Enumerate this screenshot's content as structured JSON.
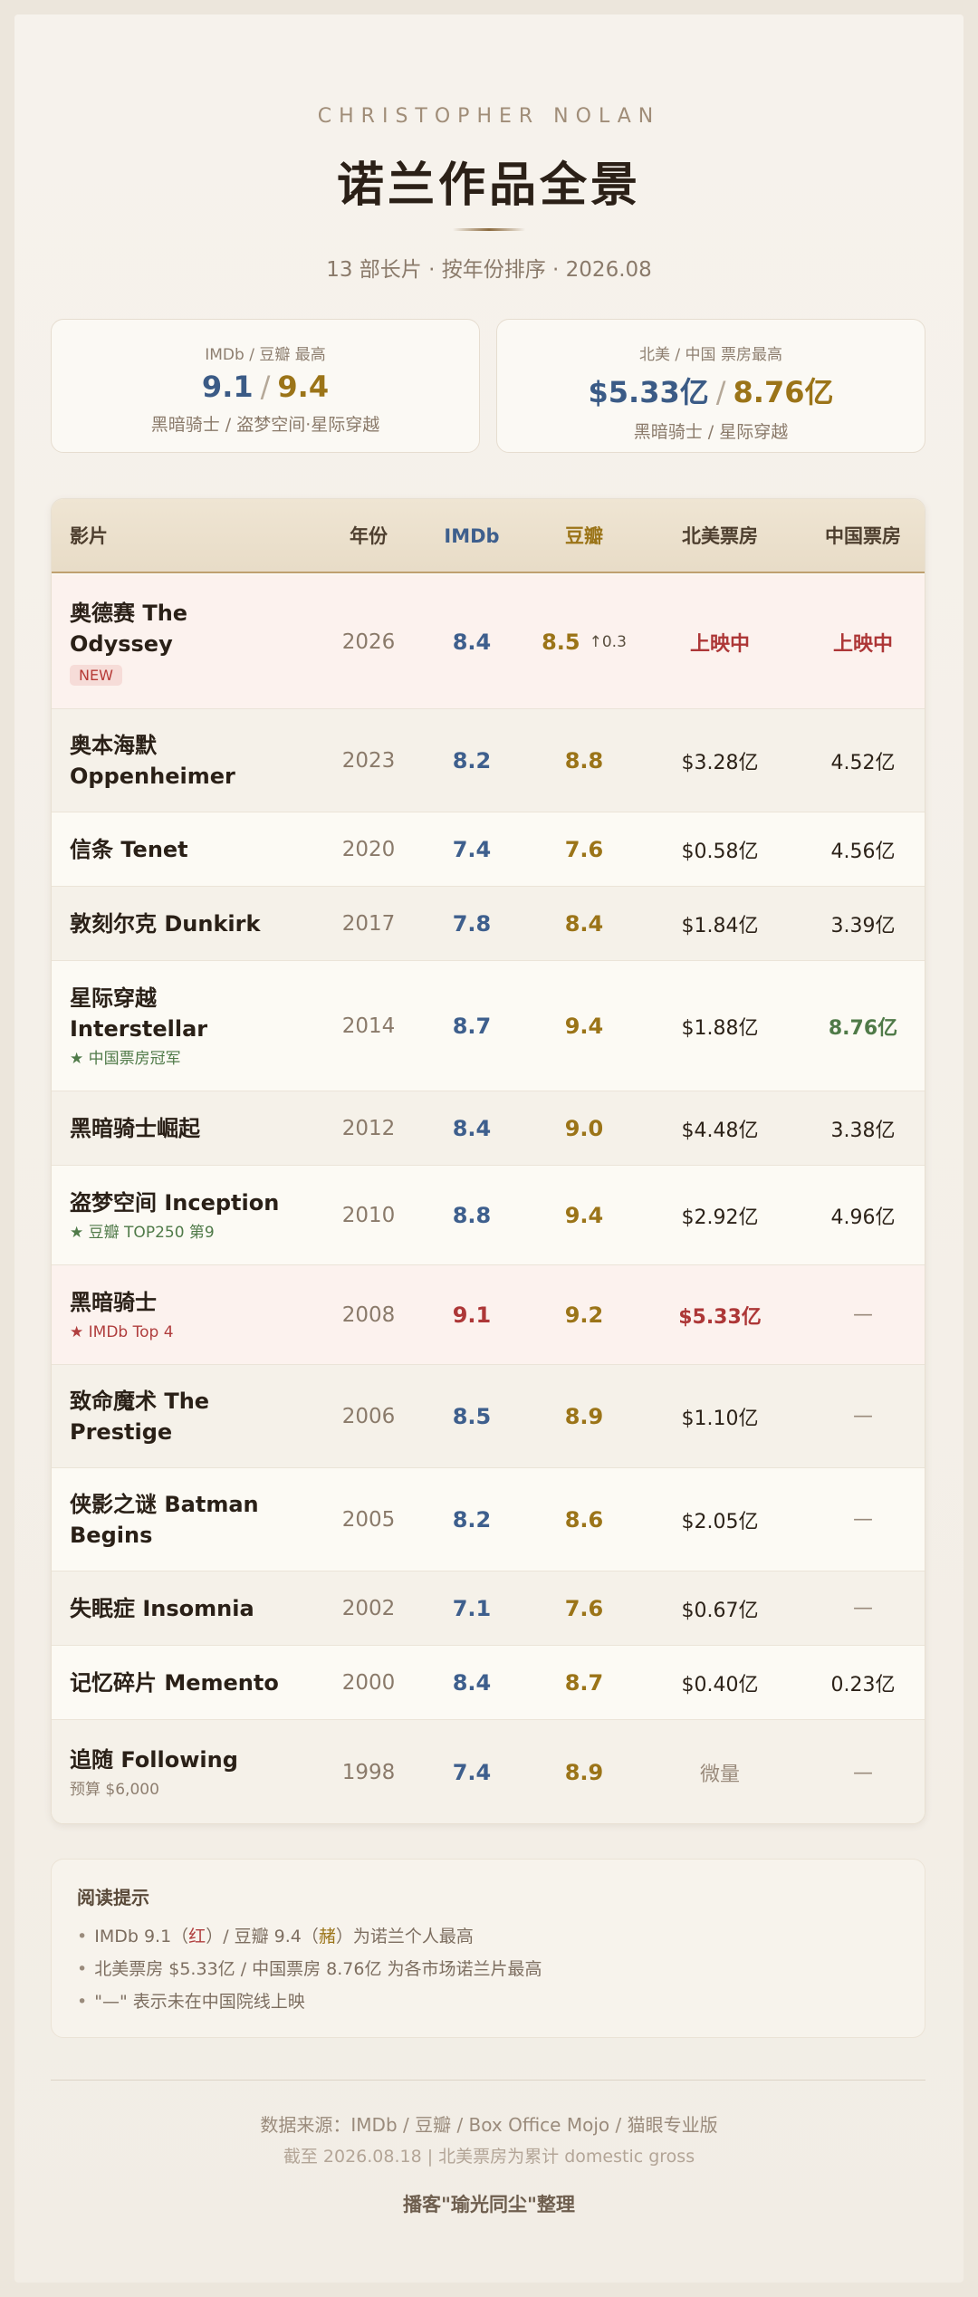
{
  "header": {
    "eyebrow": "CHRISTOPHER NOLAN",
    "title": "诺兰作品全景",
    "subtitle": "13 部长片 · 按年份排序 · 2026.08"
  },
  "summary_cards": {
    "ratings": {
      "label": "IMDb / 豆瓣 最高",
      "imdb": "9.1",
      "sep": "/",
      "douban": "9.4",
      "note": "黑暗骑士 / 盗梦空间·星际穿越"
    },
    "box_office": {
      "label": "北美 / 中国 票房最高",
      "na": "$5.33亿",
      "sep": "/",
      "cn": "8.76亿",
      "note": "黑暗骑士 / 星际穿越"
    }
  },
  "table": {
    "headers": {
      "film": "影片",
      "year": "年份",
      "imdb": "IMDb",
      "douban": "豆瓣",
      "na": "北美票房",
      "cn": "中国票房"
    },
    "rows": [
      {
        "name": "奥德赛 The Odyssey",
        "badge": "NEW",
        "year": "2026",
        "imdb": "8.4",
        "douban": "8.5",
        "delta": "↑0.3",
        "na": "上映中",
        "cn": "上映中"
      },
      {
        "name": "奥本海默 Oppenheimer",
        "year": "2023",
        "imdb": "8.2",
        "douban": "8.8",
        "na": "$3.28亿",
        "cn": "4.52亿"
      },
      {
        "name": "信条 Tenet",
        "year": "2020",
        "imdb": "7.4",
        "douban": "7.6",
        "na": "$0.58亿",
        "cn": "4.56亿"
      },
      {
        "name": "敦刻尔克 Dunkirk",
        "year": "2017",
        "imdb": "7.8",
        "douban": "8.4",
        "na": "$1.84亿",
        "cn": "3.39亿"
      },
      {
        "name": "星际穿越 Interstellar",
        "note": "★ 中国票房冠军",
        "year": "2014",
        "imdb": "8.7",
        "douban": "9.4",
        "na": "$1.88亿",
        "cn": "8.76亿"
      },
      {
        "name": "黑暗骑士崛起",
        "year": "2012",
        "imdb": "8.4",
        "douban": "9.0",
        "na": "$4.48亿",
        "cn": "3.38亿"
      },
      {
        "name": "盗梦空间 Inception",
        "note": "★ 豆瓣 TOP250 第9",
        "year": "2010",
        "imdb": "8.8",
        "douban": "9.4",
        "na": "$2.92亿",
        "cn": "4.96亿"
      },
      {
        "name": "黑暗骑士",
        "note": "★ IMDb Top 4",
        "year": "2008",
        "imdb": "9.1",
        "douban": "9.2",
        "na": "$5.33亿",
        "cn": "—"
      },
      {
        "name": "致命魔术 The Prestige",
        "year": "2006",
        "imdb": "8.5",
        "douban": "8.9",
        "na": "$1.10亿",
        "cn": "—"
      },
      {
        "name": "侠影之谜 Batman Begins",
        "year": "2005",
        "imdb": "8.2",
        "douban": "8.6",
        "na": "$2.05亿",
        "cn": "—"
      },
      {
        "name": "失眠症 Insomnia",
        "year": "2002",
        "imdb": "7.1",
        "douban": "7.6",
        "na": "$0.67亿",
        "cn": "—"
      },
      {
        "name": "记忆碎片 Memento",
        "year": "2000",
        "imdb": "8.4",
        "douban": "8.7",
        "na": "$0.40亿",
        "cn": "0.23亿"
      },
      {
        "name": "追随 Following",
        "note": "预算 $6,000",
        "year": "1998",
        "imdb": "7.4",
        "douban": "8.9",
        "na": "微量",
        "cn": "—"
      }
    ]
  },
  "tips": {
    "title": "阅读提示",
    "items": [
      {
        "a": "IMDb 9.1（",
        "b": "红",
        "c": "）/ 豆瓣 9.4（",
        "d": "赭",
        "e": "）为诺兰个人最高"
      },
      {
        "text": "北美票房 $5.33亿 / 中国票房 8.76亿 为各市场诺兰片最高"
      },
      {
        "text": "\"—\" 表示未在中国院线上映"
      }
    ]
  },
  "footer": {
    "source": "数据来源：IMDb / 豆瓣 / Box Office Mojo / 猫眼专业版",
    "date": "截至 2026.08.18 | 北美票房为累计 domestic gross",
    "credit": "播客\"瑜光同尘\"整理"
  }
}
